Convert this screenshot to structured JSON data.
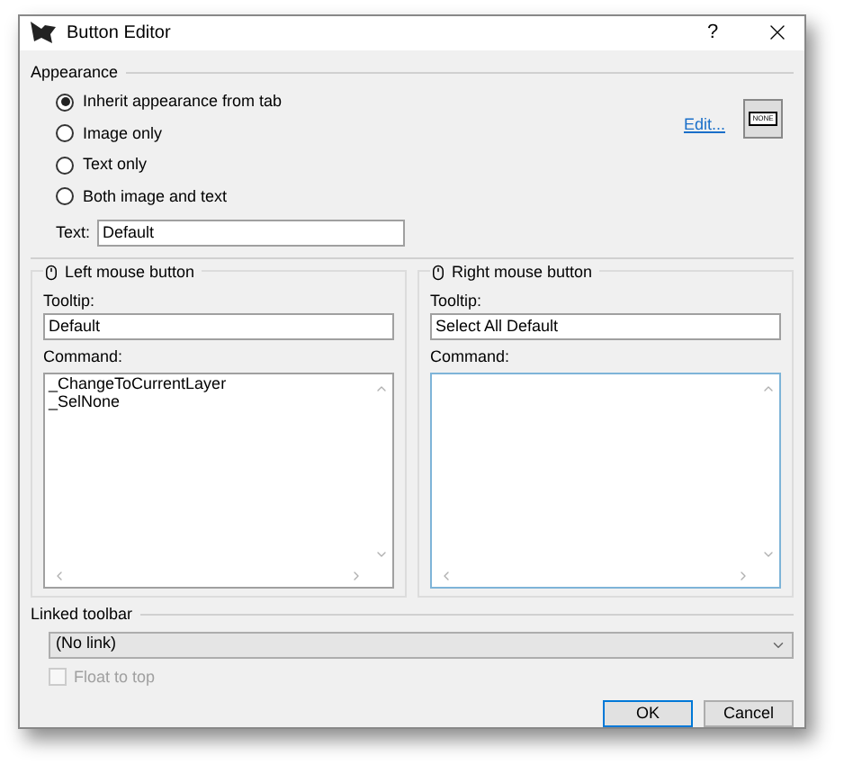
{
  "window": {
    "title": "Button Editor",
    "help": "?"
  },
  "appearance": {
    "label": "Appearance",
    "options": [
      {
        "label": "Inherit appearance from tab",
        "selected": true
      },
      {
        "label": "Image only",
        "selected": false
      },
      {
        "label": "Text only",
        "selected": false
      },
      {
        "label": "Both image and text",
        "selected": false
      }
    ],
    "text_label": "Text:",
    "text_value": "Default",
    "edit_link": "Edit...",
    "preview_text": "NONE"
  },
  "mouse_buttons": [
    {
      "label": "Left mouse button",
      "tooltip_label": "Tooltip:",
      "tooltip": "Default",
      "command_label": "Command:",
      "command_lines": [
        "_ChangeToCurrentLayer",
        "_SelNone"
      ],
      "focused": false
    },
    {
      "label": "Right mouse button",
      "tooltip_label": "Tooltip:",
      "tooltip": "Select All Default",
      "command_label": "Command:",
      "focused": true
    }
  ],
  "linked_toolbar": {
    "label": "Linked toolbar",
    "value": "(No link)",
    "float": {
      "label": "Float to top",
      "checked": false,
      "disabled": true
    }
  },
  "buttons": [
    {
      "label": "OK",
      "default": true
    },
    {
      "label": "Cancel",
      "default": false
    }
  ]
}
